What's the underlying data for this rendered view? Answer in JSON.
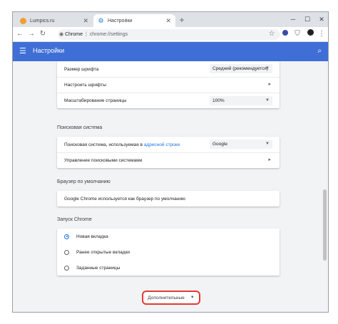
{
  "tabs": [
    {
      "title": "Lumpics.ru",
      "favicon_color": "#f0a030"
    },
    {
      "title": "Настройки",
      "favicon_color": "#1a73e8"
    }
  ],
  "new_tab_icon": "plus-icon",
  "window_controls": {
    "minimize": "─",
    "maximize": "☐",
    "close": "✕"
  },
  "omnibox": {
    "prefix": "Chrome",
    "path": "chrome://settings"
  },
  "appbar": {
    "title": "Настройки",
    "color": "#3f6fd6"
  },
  "appearance": {
    "font_size_label": "Размер шрифта",
    "font_size_value": "Средний (рекомендуется)",
    "customize_fonts_label": "Настроить шрифты",
    "zoom_label": "Масштабирование страницы",
    "zoom_value": "100%"
  },
  "search_engine": {
    "section_title": "Поисковая система",
    "label_prefix": "Поисковая система, используемая в",
    "label_link": "адресной строке",
    "value": "Google",
    "manage_label": "Управление поисковыми системами"
  },
  "default_browser": {
    "section_title": "Браузер по умолчанию",
    "status": "Google Chrome используется как браузер по умолчанию"
  },
  "on_startup": {
    "section_title": "Запуск Chrome",
    "options": [
      "Новая вкладка",
      "Ранее открытые вкладки",
      "Заданные страницы"
    ],
    "selected_index": 0
  },
  "advanced_button": "Дополнительные"
}
